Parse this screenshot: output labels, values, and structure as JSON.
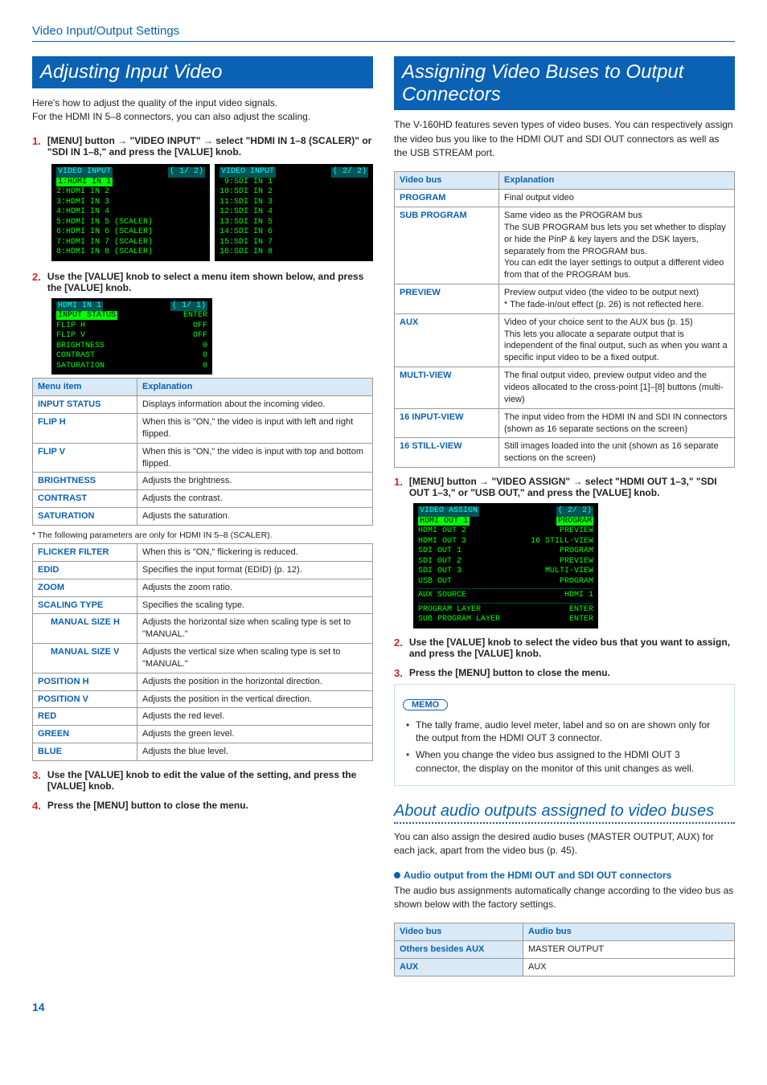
{
  "breadcrumb": "Video Input/Output Settings",
  "page_number": "14",
  "left": {
    "heading": "Adjusting Input Video",
    "intro1": "Here's how to adjust the quality of the input video signals.",
    "intro2": "For the HDMI IN 5–8 connectors, you can also adjust the scaling.",
    "step1_pre": "[MENU] button ",
    "step1_mid1": " \"VIDEO INPUT\" ",
    "step1_post": " select \"HDMI IN 1–8 (SCALER)\" or \"SDI IN 1–8,\" and press the [VALUE] knob.",
    "screen1_left_title": "VIDEO INPUT",
    "screen1_left_page": "( 1/ 2)",
    "screen1_left_lines": [
      "1:HDMI IN 1",
      "2:HDMI IN 2",
      "3:HDMI IN 3",
      "4:HDMI IN 4",
      "5:HDMI IN 5 (SCALER)",
      "6:HDMI IN 6 (SCALER)",
      "7:HDMI IN 7 (SCALER)",
      "8:HDMI IN 8 (SCALER)"
    ],
    "screen1_right_title": "VIDEO INPUT",
    "screen1_right_page": "( 2/ 2)",
    "screen1_right_lines": [
      " 9:SDI IN 1",
      "10:SDI IN 2",
      "11:SDI IN 3",
      "12:SDI IN 4",
      "13:SDI IN 5",
      "14:SDI IN 6",
      "15:SDI IN 7",
      "16:SDI IN 8"
    ],
    "step2": "Use the [VALUE] knob to select a menu item shown below, and press the [VALUE] knob.",
    "screen2_title": "HDMI IN 1",
    "screen2_page": "( 1/ 1)",
    "screen2_rows": [
      [
        "INPUT STATUS",
        "ENTER"
      ],
      [
        "FLIP H",
        "OFF"
      ],
      [
        "FLIP V",
        "OFF"
      ],
      [
        "BRIGHTNESS",
        "0"
      ],
      [
        "CONTRAST",
        "0"
      ],
      [
        "SATURATION",
        "0"
      ]
    ],
    "table1_headers": [
      "Menu item",
      "Explanation"
    ],
    "table1_rows": [
      [
        "INPUT STATUS",
        "Displays information about the incoming video."
      ],
      [
        "FLIP H",
        "When this is \"ON,\" the video is input with left and right flipped."
      ],
      [
        "FLIP V",
        "When this is \"ON,\" the video is input with top and bottom flipped."
      ],
      [
        "BRIGHTNESS",
        "Adjusts the brightness."
      ],
      [
        "CONTRAST",
        "Adjusts the contrast."
      ],
      [
        "SATURATION",
        "Adjusts the saturation."
      ]
    ],
    "footnote": "* The following parameters are only for HDMI IN 5–8 (SCALER).",
    "table2_rows": [
      [
        "FLICKER FILTER",
        "When this is \"ON,\" flickering is reduced.",
        false
      ],
      [
        "EDID",
        "Specifies the input format (EDID) (p. 12).",
        false
      ],
      [
        "ZOOM",
        "Adjusts the zoom ratio.",
        false
      ],
      [
        "SCALING TYPE",
        "Specifies the scaling type.",
        false
      ],
      [
        "MANUAL SIZE H",
        "Adjusts the horizontal size when scaling type is set to \"MANUAL.\"",
        true
      ],
      [
        "MANUAL SIZE V",
        "Adjusts the vertical size when scaling type is set to \"MANUAL.\"",
        true
      ],
      [
        "POSITION H",
        "Adjusts the position in the horizontal direction.",
        false
      ],
      [
        "POSITION V",
        "Adjusts the position in the vertical direction.",
        false
      ],
      [
        "RED",
        "Adjusts the red level.",
        false
      ],
      [
        "GREEN",
        "Adjusts the green level.",
        false
      ],
      [
        "BLUE",
        "Adjusts the blue level.",
        false
      ]
    ],
    "step3": "Use the [VALUE] knob to edit the value of the setting, and press the [VALUE] knob.",
    "step4": "Press the [MENU] button to close the menu."
  },
  "right": {
    "heading": "Assigning Video Buses to Output Connectors",
    "intro": "The V-160HD features seven types of video buses. You can respectively assign the video bus you like to the HDMI OUT and SDI OUT connectors as well as the USB STREAM port.",
    "bus_headers": [
      "Video bus",
      "Explanation"
    ],
    "bus_rows": [
      [
        "PROGRAM",
        "Final output video"
      ],
      [
        "SUB PROGRAM",
        "Same video as the PROGRAM bus\nThe SUB PROGRAM bus lets you set whether to display or hide the PinP & key layers and the DSK layers, separately from the PROGRAM bus.\nYou can edit the layer settings to output a different video from that of the PROGRAM bus."
      ],
      [
        "PREVIEW",
        "Preview output video (the video to be output next)\n* The fade-in/out effect (p. 26) is not reflected here."
      ],
      [
        "AUX",
        "Video of your choice sent to the AUX bus (p. 15)\nThis lets you allocate a separate output that is independent of the final output, such as when you want a specific input video to be a fixed output."
      ],
      [
        "MULTI-VIEW",
        "The final output video, preview output video and the videos allocated to the cross-point [1]–[8] buttons (multi-view)"
      ],
      [
        "16 INPUT-VIEW",
        "The input video from the HDMI IN and SDI IN connectors (shown as 16 separate sections on the screen)"
      ],
      [
        "16 STILL-VIEW",
        "Still images loaded into the unit (shown as 16 separate sections on the screen)"
      ]
    ],
    "step1_pre": "[MENU] button ",
    "step1_mid": " \"VIDEO ASSIGN\" ",
    "step1_post": " select \"HDMI OUT 1–3,\" \"SDI OUT 1–3,\" or \"USB OUT,\" and press the [VALUE] knob.",
    "screen_title_l": "VIDEO ASSIGN",
    "screen_title_r": "( 2/ 2)",
    "screen_rows": [
      [
        "HDMI OUT 1",
        "PROGRAM",
        true
      ],
      [
        "HDMI OUT 2",
        "PREVIEW",
        false
      ],
      [
        "HDMI OUT 3",
        "16 STILL-VIEW",
        false
      ],
      [
        "SDI OUT 1",
        "PROGRAM",
        false
      ],
      [
        "SDI OUT 2",
        "PREVIEW",
        false
      ],
      [
        "SDI OUT 3",
        "MULTI-VIEW",
        false
      ],
      [
        "USB OUT",
        "PROGRAM",
        false
      ]
    ],
    "screen_aux_row": [
      "AUX SOURCE",
      "HDMI 1"
    ],
    "screen_layer_rows": [
      [
        "PROGRAM LAYER",
        "ENTER"
      ],
      [
        "SUB PROGRAM LAYER",
        "ENTER"
      ]
    ],
    "step2": "Use the [VALUE] knob to select the video bus that you want to assign, and press the [VALUE] knob.",
    "step3": "Press the [MENU] button to close the menu.",
    "memo_label": "MEMO",
    "memo_items": [
      "The tally frame, audio level meter, label and so on are shown only for the output from the HDMI OUT 3 connector.",
      "When you change the video bus assigned to the HDMI OUT 3 connector, the display on the monitor of this unit changes as well."
    ],
    "h2": "About audio outputs assigned to video buses",
    "audio_intro": "You can also assign the desired audio buses (MASTER OUTPUT, AUX) for each jack, apart from the video bus (p. 45).",
    "audio_sect_title": "Audio output from the HDMI OUT and SDI OUT connectors",
    "audio_note": "The audio bus assignments automatically change according to the video bus as shown below with the factory settings.",
    "audio_headers": [
      "Video bus",
      "Audio bus"
    ],
    "audio_rows": [
      [
        "Others besides AUX",
        "MASTER OUTPUT"
      ],
      [
        "AUX",
        "AUX"
      ]
    ]
  }
}
